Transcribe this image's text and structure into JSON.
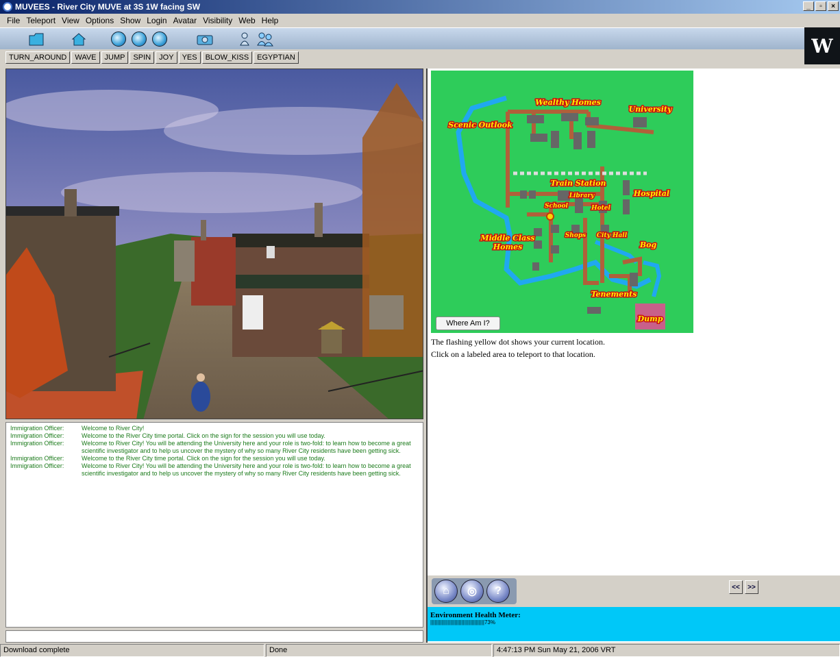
{
  "window": {
    "title": "MUVEES - River City MUVE at 3S 1W facing SW"
  },
  "menu": [
    "File",
    "Teleport",
    "View",
    "Options",
    "Show",
    "Login",
    "Avatar",
    "Visibility",
    "Web",
    "Help"
  ],
  "logo_text": "W",
  "toolbar_icons": [
    "folder-icon",
    "home-icon",
    "globe-back-icon",
    "globe-icon",
    "globe-forward-icon",
    "camera-icon",
    "person-icon",
    "people-icon"
  ],
  "gestures": [
    "TURN_AROUND",
    "WAVE",
    "JUMP",
    "SPIN",
    "JOY",
    "YES",
    "BLOW_KISS",
    "EGYPTIAN"
  ],
  "chat": [
    {
      "who": "Immigration Officer:",
      "msg": "Welcome to River City!"
    },
    {
      "who": "Immigration Officer:",
      "msg": "Welcome to the River City time portal. Click on the sign for the session you will use today."
    },
    {
      "who": "Immigration Officer:",
      "msg": "Welcome to River City! You will be attending the University here  and your role is two-fold: to learn how to become a great scientific investigator and to help us uncover the mystery of why so many River City residents have been getting sick."
    },
    {
      "who": "Immigration Officer:",
      "msg": "Welcome to the River City time portal. Click on the sign for the session you will use today."
    },
    {
      "who": "Immigration Officer:",
      "msg": "Welcome to River City! You will be attending the University here  and your role is two-fold: to learn how to become a great scientific investigator and to help us uncover the mystery of why so many River City residents have been getting sick."
    }
  ],
  "map": {
    "labels": {
      "wealthy": "Wealthy Homes",
      "university": "University",
      "scenic": "Scenic Outlook",
      "train": "Train Station",
      "library": "Library",
      "hospital": "Hospital",
      "school": "School",
      "hotel": "Hotel",
      "middle1": "Middle Class",
      "middle2": "Homes",
      "shops": "Shops",
      "cityhall": "City Hall",
      "bog": "Bog",
      "tenements": "Tenements",
      "dump": "Dump"
    },
    "where_button": "Where Am I?"
  },
  "info": {
    "line1": "The flashing yellow dot shows your current location.",
    "line2": "Click on a labeled area to teleport to that location."
  },
  "nav": {
    "prev": "<<",
    "next": ">>"
  },
  "health": {
    "title": "Environment Health Meter:",
    "bars": "||||||||||||||||||||||||||||||||||||||",
    "percent": "73%",
    "value": 0.73
  },
  "status": {
    "left": "Download complete",
    "middle": "Done",
    "right": "4:47:13 PM Sun May 21, 2006 VRT"
  },
  "colors": {
    "map_bg": "#2ecc5a",
    "road": "#b0603a",
    "river": "#20a8f0",
    "meter_bg": "#00c8f8"
  }
}
